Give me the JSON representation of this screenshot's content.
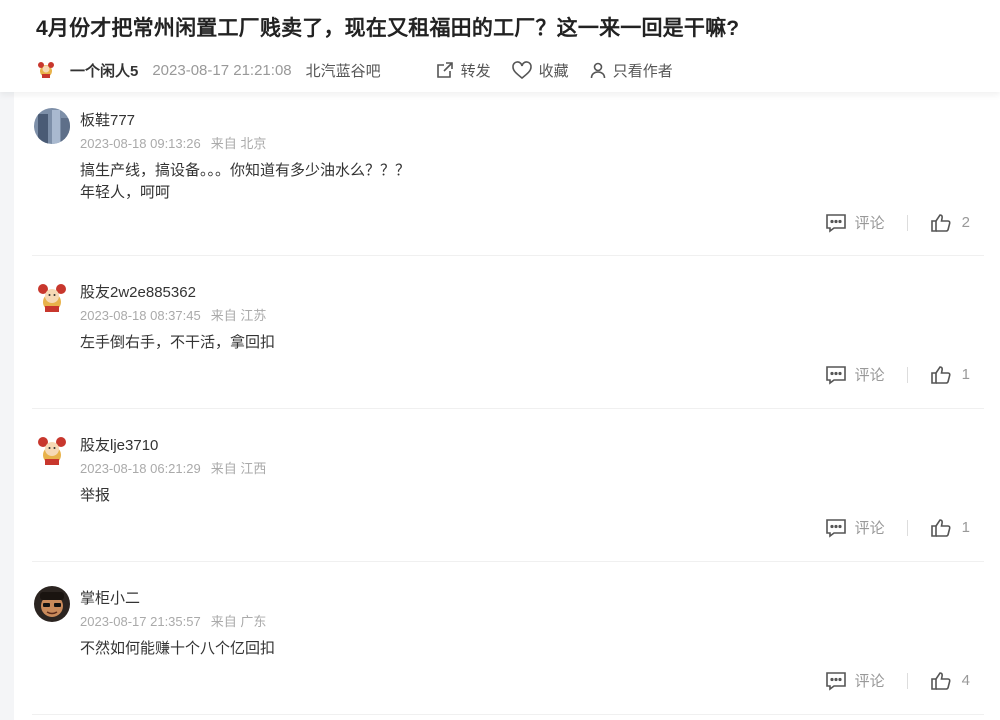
{
  "post": {
    "title": "4月份才把常州闲置工厂贱卖了，现在又租福田的工厂？这一来一回是干嘛?",
    "author": "一个闲人5",
    "date": "2023-08-17 21:21:08",
    "forum": "北汽蓝谷吧",
    "actions": {
      "share": "转发",
      "favorite": "收藏",
      "only_author": "只看作者"
    }
  },
  "labels": {
    "comment": "评论",
    "from_prefix": "来自"
  },
  "comments": [
    {
      "username": "板鞋777",
      "date": "2023-08-18 09:13:26",
      "location": "北京",
      "text": "搞生产线，搞设备。。。你知道有多少油水么？？？\n年轻人，呵呵",
      "likes": "2",
      "avatar": "photo-avatar"
    },
    {
      "username": "股友2w2e885362",
      "date": "2023-08-18 08:37:45",
      "location": "江苏",
      "text": "左手倒右手，不干活，拿回扣",
      "likes": "1",
      "avatar": "cartoon-avatar"
    },
    {
      "username": "股友lje3710",
      "date": "2023-08-18 06:21:29",
      "location": "江西",
      "text": "举报",
      "likes": "1",
      "avatar": "cartoon-avatar"
    },
    {
      "username": "掌柜小二",
      "date": "2023-08-17 21:35:57",
      "location": "广东",
      "text": "不然如何能赚十个八个亿回扣",
      "likes": "4",
      "avatar": "photo-avatar"
    }
  ]
}
